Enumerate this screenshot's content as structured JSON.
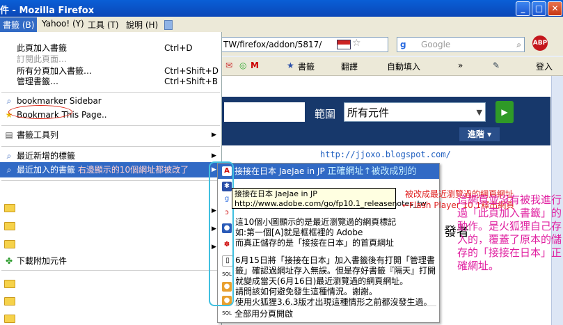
{
  "window": {
    "title": "件 - Mozilla Firefox",
    "btn_min": "_",
    "btn_max": "□",
    "btn_close": "✕"
  },
  "menubar": {
    "items": [
      "書籤 (B)",
      "Yahoo! (Y)",
      "工具 (T)",
      "說明 (H)"
    ]
  },
  "navbar": {
    "url": "TW/firefox/addon/5817/",
    "search_placeholder": "Google",
    "abp": "ABP"
  },
  "toolbar2": {
    "items": [
      "書籤",
      "翻譯",
      "自動填入",
      "»",
      "登入"
    ]
  },
  "page": {
    "scope_label": "範圍",
    "scope_value": "所有元件",
    "advanced": "進階",
    "go_arrow": "▶",
    "blog_url": "http://jjoxo.blogspot.com/",
    "page_text": "發者"
  },
  "bookmarks_menu": {
    "add_page": "此頁加入書籤",
    "add_page_key": "Ctrl+D",
    "subscribe": "訂閱此頁面…",
    "add_all": "所有分頁加入書籤…",
    "add_all_key": "Ctrl+Shift+D",
    "manage": "管理書籤…",
    "manage_key": "Ctrl+Shift+B",
    "sidebar": "bookmarker Sidebar",
    "bookmark_this": "Bookmark This Page..",
    "toolbar": "書籤工具列",
    "recent_tags": "最近新增的標籤",
    "recent_bookmarks": "最近加入的書籤",
    "recent_note": "右邊顯示的10個網址都被改了",
    "addons": "下載附加元件"
  },
  "submenu": {
    "first": "接接在日本 JaeJae in JP",
    "first_note": "正確網址↑被改成別的",
    "open_all": "全部用分頁開啟"
  },
  "tooltip": {
    "line1": "接接在日本 JaeJae in JP",
    "line2": "http://www.adobe.com/go/fp10.1_releasenotes_tw"
  },
  "annotations": {
    "changed": "被改成最近瀏覽過的網頁網址",
    "flash": "←Flash Player 10.1釋出網頁",
    "explain": [
      "這10個小圖顯示的是最近瀏覽過的網頁標記",
      "如:第一個[A]就是框框裡的 Adobe",
      "而真正儲存的是「接接在日本」的首頁網址",
      "6月15日將「接接在日本」加入書籤後有打開「管理書",
      "籤」確認過網址存入無誤。但是存好書籤『隔天』打開",
      "就變成當天(6月16日)最近瀏覽過的網頁網址。",
      "請問該如何避免發生這種情況。謝謝。",
      "使用火狐狸3.6.3版才出現這種情形之前都沒發生過。"
    ],
    "right": "這網頁並沒有被我進行過「此頁加入書籤」的動作。是火狐狸自己存入的，覆蓋了原本的儲存的「接接在日本」正確網址。"
  }
}
